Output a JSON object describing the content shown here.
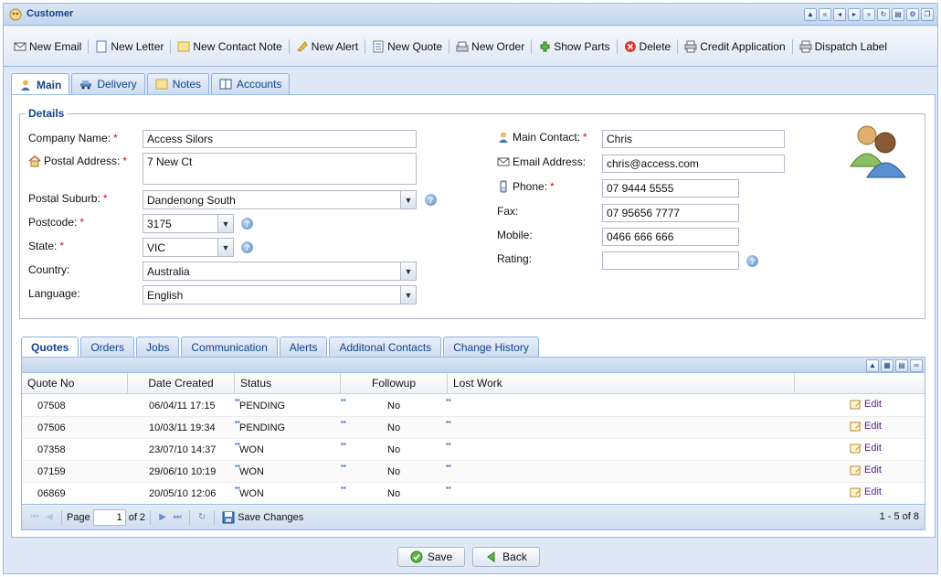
{
  "window": {
    "title": "Customer"
  },
  "toolbar": {
    "items": [
      {
        "label": "New Email",
        "icon": "email-icon"
      },
      {
        "label": "New Letter",
        "icon": "letter-icon"
      },
      {
        "label": "New Contact Note",
        "icon": "note-icon"
      },
      {
        "label": "New Alert",
        "icon": "alert-icon"
      },
      {
        "label": "New Quote",
        "icon": "quote-icon"
      },
      {
        "label": "New Order",
        "icon": "order-icon"
      },
      {
        "label": "Show Parts",
        "icon": "parts-icon"
      },
      {
        "label": "Delete",
        "icon": "delete-icon"
      },
      {
        "label": "Credit Application",
        "icon": "printer-icon"
      },
      {
        "label": "Dispatch Label",
        "icon": "printer-icon"
      }
    ]
  },
  "main_tabs": [
    {
      "label": "Main",
      "icon": "user-icon"
    },
    {
      "label": "Delivery",
      "icon": "car-icon"
    },
    {
      "label": "Notes",
      "icon": "note-icon"
    },
    {
      "label": "Accounts",
      "icon": "book-icon"
    }
  ],
  "details": {
    "legend": "Details",
    "company_name": {
      "label": "Company Name:",
      "value": "Access Silors"
    },
    "postal_address": {
      "label": "Postal Address:",
      "value": "7 New Ct"
    },
    "postal_suburb": {
      "label": "Postal Suburb:",
      "value": "Dandenong South"
    },
    "postcode": {
      "label": "Postcode:",
      "value": "3175"
    },
    "state": {
      "label": "State:",
      "value": "VIC"
    },
    "country": {
      "label": "Country:",
      "value": "Australia"
    },
    "language": {
      "label": "Language:",
      "value": "English"
    },
    "main_contact": {
      "label": "Main Contact:",
      "value": "Chris"
    },
    "email": {
      "label": "Email Address:",
      "value": "chris@access.com"
    },
    "phone": {
      "label": "Phone:",
      "value": "07 9444 5555"
    },
    "fax": {
      "label": "Fax:",
      "value": "07 95656 7777"
    },
    "mobile": {
      "label": "Mobile:",
      "value": "0466 666 666"
    },
    "rating": {
      "label": "Rating:",
      "value": ""
    },
    "required_marker": "*"
  },
  "sub_tabs": [
    "Quotes",
    "Orders",
    "Jobs",
    "Communication",
    "Alerts",
    "Additonal Contacts",
    "Change History"
  ],
  "grid": {
    "columns": [
      "Quote No",
      "Date Created",
      "Status",
      "Followup",
      "Lost Work"
    ],
    "edit_label": "Edit",
    "rows": [
      {
        "quote_no": "07508",
        "date": "06/04/11 17:15",
        "status": "PENDING",
        "followup": "No",
        "lost_work": ""
      },
      {
        "quote_no": "07506",
        "date": "10/03/11 19:34",
        "status": "PENDING",
        "followup": "No",
        "lost_work": ""
      },
      {
        "quote_no": "07358",
        "date": "23/07/10 14:37",
        "status": "WON",
        "followup": "No",
        "lost_work": ""
      },
      {
        "quote_no": "07159",
        "date": "29/06/10 10:19",
        "status": "WON",
        "followup": "No",
        "lost_work": ""
      },
      {
        "quote_no": "06869",
        "date": "20/05/10 12:06",
        "status": "WON",
        "followup": "No",
        "lost_work": ""
      }
    ]
  },
  "pager": {
    "page_label": "Page",
    "page_value": "1",
    "of_label": "of 2",
    "save_label": "Save Changes",
    "count": "1 - 5 of 8"
  },
  "footer": {
    "save_label": "Save",
    "back_label": "Back"
  }
}
